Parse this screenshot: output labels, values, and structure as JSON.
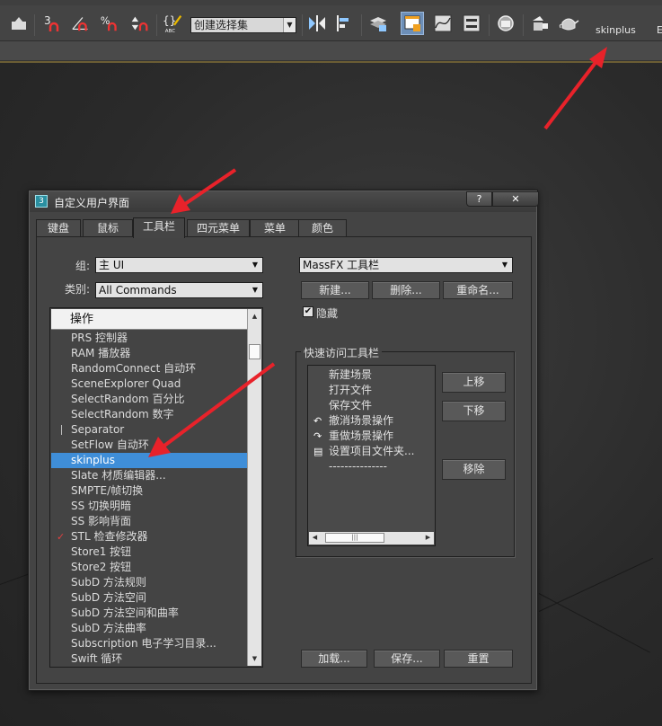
{
  "toolbar": {
    "named_selection_set": "创建选择集",
    "named_selection_placeholder": "创建选择集",
    "skinplus_label": "skinplus",
    "trailing_label": "E",
    "icons": [
      "save-icon",
      "snap-3d-icon",
      "angle-snap-icon",
      "percent-snap-icon",
      "spinner-snap-icon",
      "edit-named-selection-icon",
      "mirror-icon",
      "align-icon",
      "layer-manager-icon",
      "scene-explorer-icon",
      "curve-editor-icon",
      "schematic-view-icon",
      "material-editor-icon",
      "render-setup-icon",
      "render-frame-icon",
      "render-teapot-icon"
    ]
  },
  "dialog": {
    "title": "自定义用户界面",
    "help_button": "?",
    "close_button": "✕",
    "tabs": [
      {
        "label": "键盘"
      },
      {
        "label": "鼠标"
      },
      {
        "label": "工具栏"
      },
      {
        "label": "四元菜单"
      },
      {
        "label": "菜单"
      },
      {
        "label": "颜色"
      }
    ],
    "active_tab": "工具栏",
    "group_label": "组:",
    "group_value": "主 UI",
    "category_label": "类别:",
    "category_value": "All Commands",
    "toolbar_combo_value": "MassFX 工具栏",
    "new_button": "新建...",
    "delete_button": "删除...",
    "rename_button": "重命名...",
    "hide_checkbox_label": "隐藏",
    "hide_checked": true,
    "action_header": "操作",
    "actions": [
      {
        "label": "PRS 控制器"
      },
      {
        "label": "RAM 播放器"
      },
      {
        "label": "RandomConnect 自动环"
      },
      {
        "label": "SceneExplorer Quad"
      },
      {
        "label": "SelectRandom 百分比"
      },
      {
        "label": "SelectRandom 数字"
      },
      {
        "label": "Separator",
        "icon": "separator-icon"
      },
      {
        "label": "SetFlow 自动环"
      },
      {
        "label": "skinplus",
        "selected": true
      },
      {
        "label": "Slate 材质编辑器..."
      },
      {
        "label": "SMPTE/帧切换"
      },
      {
        "label": "SS 切换明暗"
      },
      {
        "label": "SS 影响背面"
      },
      {
        "label": "STL 检查修改器",
        "icon": "stl-check-icon"
      },
      {
        "label": "Store1 按钮"
      },
      {
        "label": "Store2 按钮"
      },
      {
        "label": "SubD 方法规则"
      },
      {
        "label": "SubD 方法空间"
      },
      {
        "label": "SubD 方法空间和曲率"
      },
      {
        "label": "SubD 方法曲率"
      },
      {
        "label": "Subscription 电子学习目录..."
      },
      {
        "label": "Swift 循环"
      }
    ],
    "quick_access_title": "快速访问工具栏",
    "quick_access_items": [
      {
        "label": "新建场景",
        "icon": ""
      },
      {
        "label": "打开文件",
        "icon": ""
      },
      {
        "label": "保存文件",
        "icon": ""
      },
      {
        "label": "撤消场景操作",
        "icon": "undo-icon"
      },
      {
        "label": "重做场景操作",
        "icon": "redo-icon"
      },
      {
        "label": "设置项目文件夹...",
        "icon": "project-folder-icon"
      },
      {
        "label": "---------------",
        "icon": ""
      }
    ],
    "move_up_button": "上移",
    "move_down_button": "下移",
    "remove_button": "移除",
    "load_button": "加载...",
    "save_button": "保存...",
    "reset_button": "重置"
  },
  "colors": {
    "dialog_bg": "#444444",
    "selection": "#3f8ed8",
    "annotation_arrow": "#e8222a",
    "active_toolbar_button": "#6d8fb8"
  }
}
